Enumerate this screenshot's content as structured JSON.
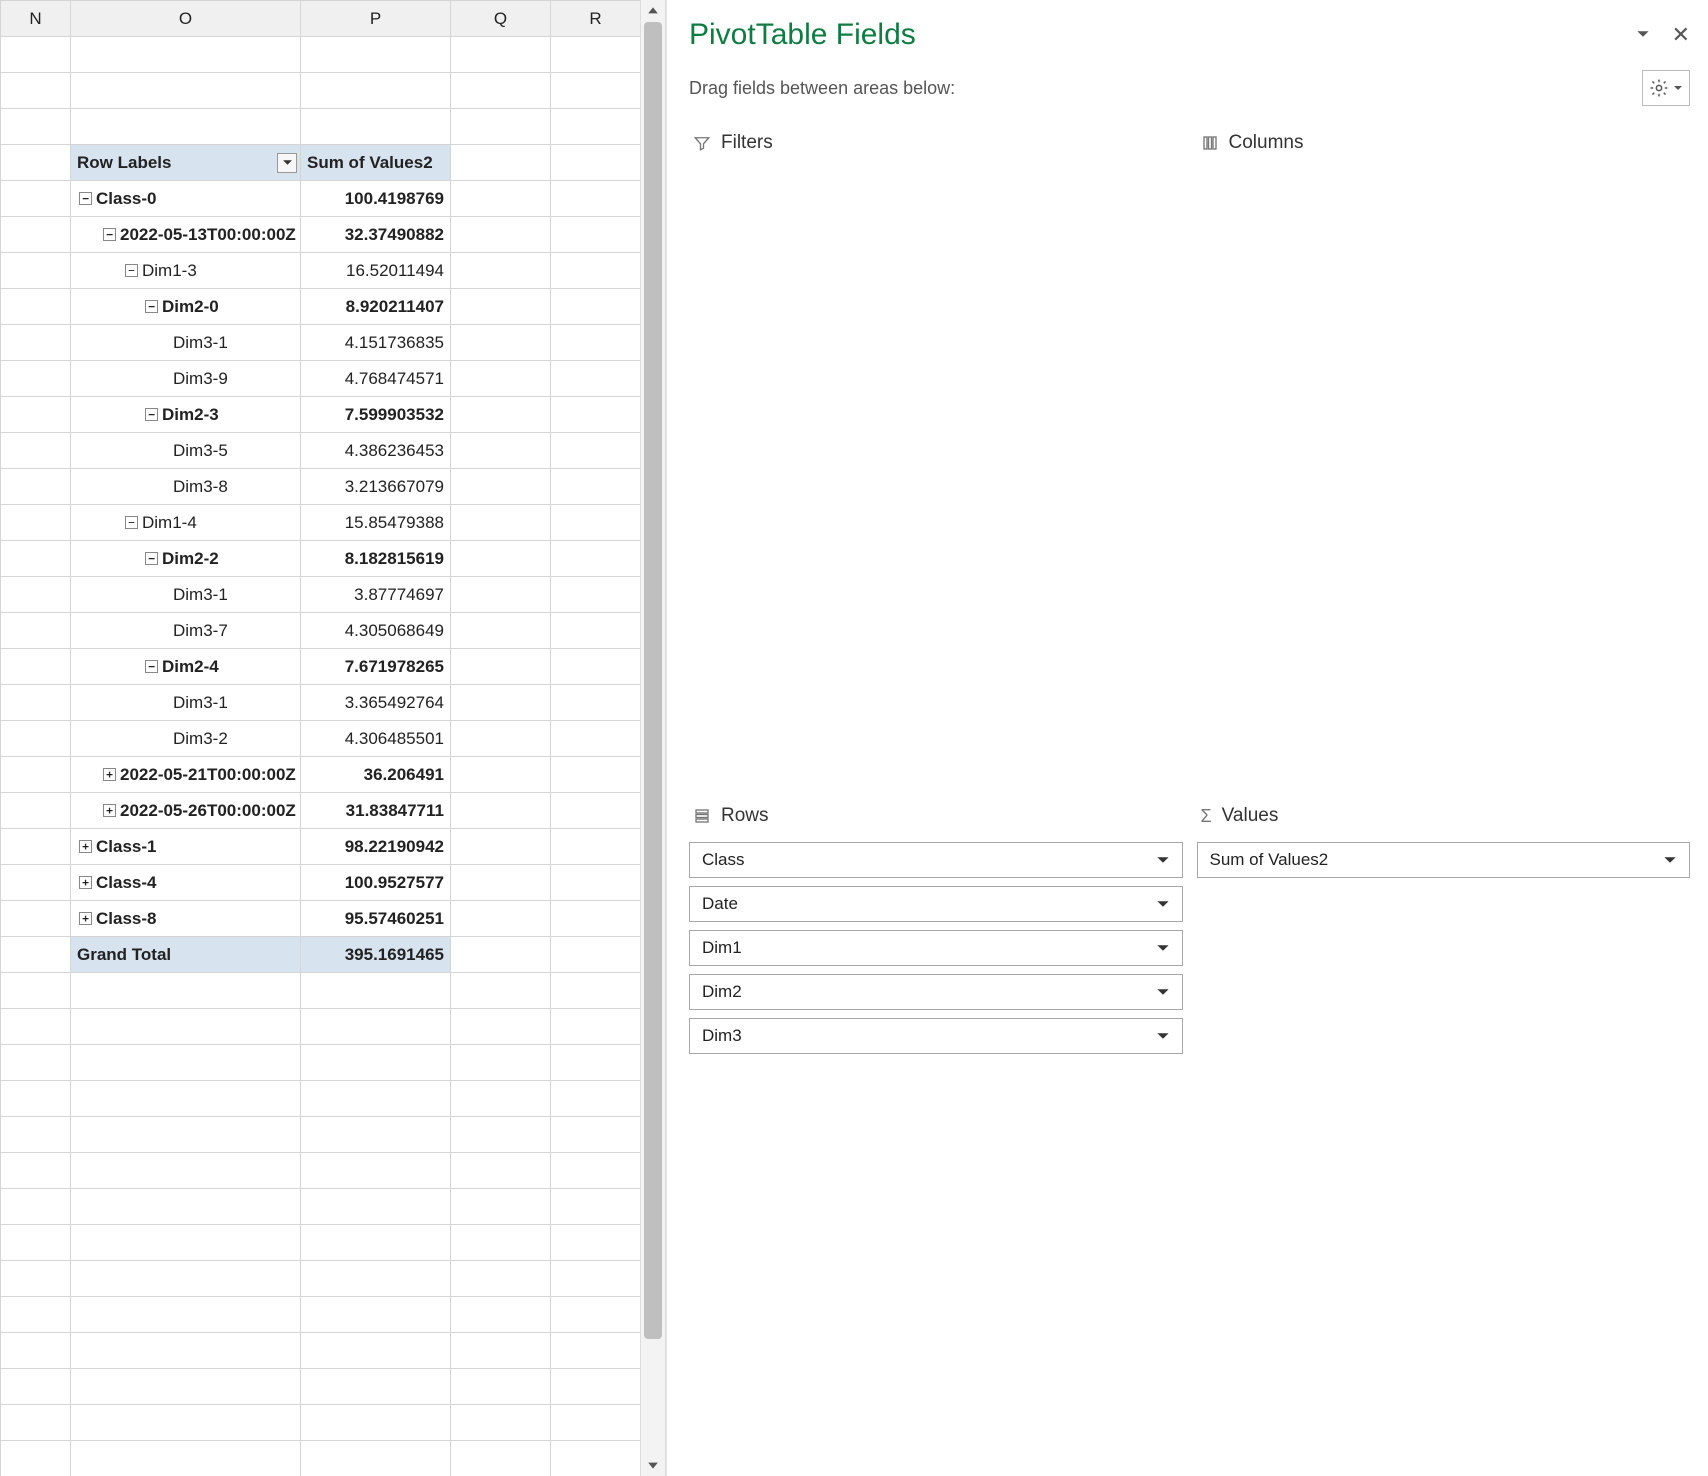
{
  "columns_header": [
    "N",
    "O",
    "P",
    "Q",
    "R"
  ],
  "pivot": {
    "row_labels_header": "Row Labels",
    "sum_header": "Sum of Values2",
    "grand_total_label": "Grand Total",
    "grand_total_value": "395.1691465",
    "rows": [
      {
        "indent": 0,
        "collapse": "-",
        "bold": true,
        "label": "Class-0",
        "value": "100.4198769"
      },
      {
        "indent": 1,
        "collapse": "-",
        "bold": true,
        "label": "2022-05-13T00:00:00Z",
        "value": "32.37490882"
      },
      {
        "indent": 2,
        "collapse": "-",
        "bold": false,
        "label": "Dim1-3",
        "value": "16.52011494"
      },
      {
        "indent": 3,
        "collapse": "-",
        "bold": true,
        "label": "Dim2-0",
        "value": "8.920211407"
      },
      {
        "indent": 4,
        "collapse": "",
        "bold": false,
        "label": "Dim3-1",
        "value": "4.151736835"
      },
      {
        "indent": 4,
        "collapse": "",
        "bold": false,
        "label": "Dim3-9",
        "value": "4.768474571"
      },
      {
        "indent": 3,
        "collapse": "-",
        "bold": true,
        "label": "Dim2-3",
        "value": "7.599903532"
      },
      {
        "indent": 4,
        "collapse": "",
        "bold": false,
        "label": "Dim3-5",
        "value": "4.386236453"
      },
      {
        "indent": 4,
        "collapse": "",
        "bold": false,
        "label": "Dim3-8",
        "value": "3.213667079"
      },
      {
        "indent": 2,
        "collapse": "-",
        "bold": false,
        "label": "Dim1-4",
        "value": "15.85479388"
      },
      {
        "indent": 3,
        "collapse": "-",
        "bold": true,
        "label": "Dim2-2",
        "value": "8.182815619"
      },
      {
        "indent": 4,
        "collapse": "",
        "bold": false,
        "label": "Dim3-1",
        "value": "3.87774697"
      },
      {
        "indent": 4,
        "collapse": "",
        "bold": false,
        "label": "Dim3-7",
        "value": "4.305068649"
      },
      {
        "indent": 3,
        "collapse": "-",
        "bold": true,
        "label": "Dim2-4",
        "value": "7.671978265"
      },
      {
        "indent": 4,
        "collapse": "",
        "bold": false,
        "label": "Dim3-1",
        "value": "3.365492764"
      },
      {
        "indent": 4,
        "collapse": "",
        "bold": false,
        "label": "Dim3-2",
        "value": "4.306485501"
      },
      {
        "indent": 1,
        "collapse": "+",
        "bold": true,
        "label": "2022-05-21T00:00:00Z",
        "value": "36.206491"
      },
      {
        "indent": 1,
        "collapse": "+",
        "bold": true,
        "label": "2022-05-26T00:00:00Z",
        "value": "31.83847711"
      },
      {
        "indent": 0,
        "collapse": "+",
        "bold": true,
        "label": "Class-1",
        "value": "98.22190942"
      },
      {
        "indent": 0,
        "collapse": "+",
        "bold": true,
        "label": "Class-4",
        "value": "100.9527577"
      },
      {
        "indent": 0,
        "collapse": "+",
        "bold": true,
        "label": "Class-8",
        "value": "95.57460251"
      }
    ]
  },
  "panel": {
    "title": "PivotTable Fields",
    "subtitle": "Drag fields between areas below:",
    "areas": {
      "filters": {
        "label": "Filters",
        "items": []
      },
      "columns": {
        "label": "Columns",
        "items": []
      },
      "rows": {
        "label": "Rows",
        "items": [
          "Class",
          "Date",
          "Dim1",
          "Dim2",
          "Dim3"
        ]
      },
      "values": {
        "label": "Values",
        "items": [
          "Sum of Values2"
        ]
      }
    }
  }
}
